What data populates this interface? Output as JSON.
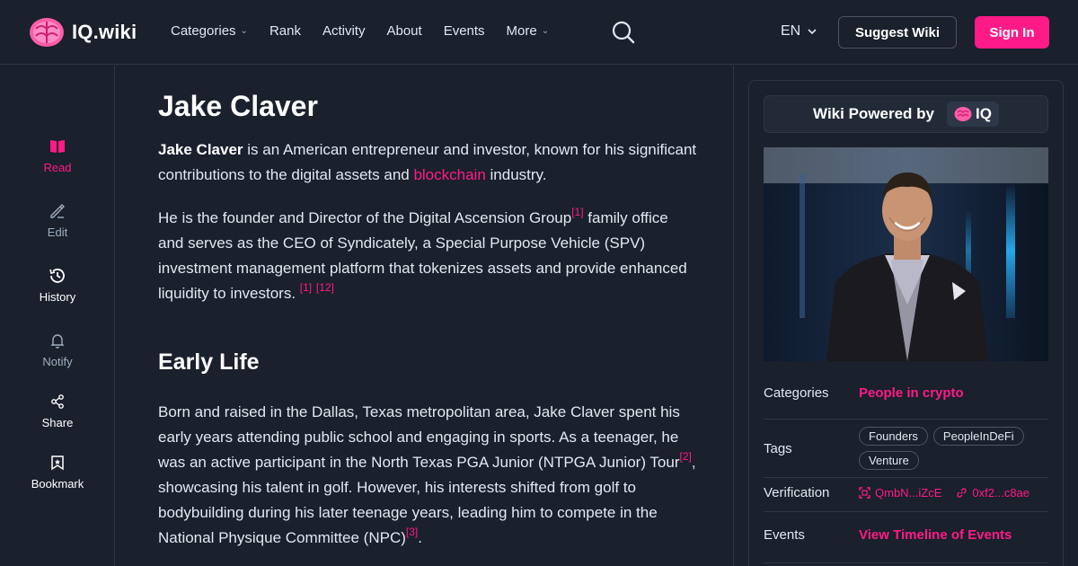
{
  "brand": {
    "name": "IQ.wiki"
  },
  "nav": {
    "links": [
      {
        "label": "Categories",
        "dropdown": true
      },
      {
        "label": "Rank",
        "dropdown": false
      },
      {
        "label": "Activity",
        "dropdown": false
      },
      {
        "label": "About",
        "dropdown": false
      },
      {
        "label": "Events",
        "dropdown": false
      },
      {
        "label": "More",
        "dropdown": true
      }
    ],
    "language": "EN",
    "suggest_label": "Suggest Wiki",
    "signin_label": "Sign In"
  },
  "rail": {
    "read": "Read",
    "edit": "Edit",
    "history": "History",
    "notify": "Notify",
    "share": "Share",
    "bookmark": "Bookmark"
  },
  "article": {
    "title": "Jake Claver",
    "intro_name": "Jake Claver",
    "intro_text_1": " is an American entrepreneur and investor, known for his significant contributions to the digital assets and ",
    "intro_link": "blockchain",
    "intro_text_2": " industry.",
    "p2_text_1": "He is the founder and Director of the Digital Ascension Group",
    "p2_ref_1": "[1]",
    "p2_text_2": " family office and serves as the CEO of Syndicately, a Special Purpose Vehicle (SPV) investment management platform that tokenizes assets and provide enhanced liquidity to investors. ",
    "p2_ref_2": "[1]",
    "p2_ref_3": "[12]",
    "section_early_life": "Early Life",
    "p3_text_1": "Born and raised in the Dallas, Texas metropolitan area, Jake Claver spent his early years attending public school and engaging in sports. As a teenager, he was an active participant in the North Texas PGA Junior (NTPGA Junior) Tour",
    "p3_ref_1": "[2]",
    "p3_text_2": ", showcasing his talent in golf. However, his interests shifted from golf to bodybuilding during his later teenage years, leading him to compete in the National Physique Committee (NPC)",
    "p3_ref_2": "[3]",
    "p3_text_3": "."
  },
  "sidebar": {
    "powered_label": "Wiki Powered by",
    "iq_label": "IQ",
    "categories_label": "Categories",
    "categories_value": "People in crypto",
    "tags_label": "Tags",
    "tags": [
      "Founders",
      "PeopleInDeFi",
      "Venture"
    ],
    "verification_label": "Verification",
    "ipfs_hash": "QmbN...iZcE",
    "tx_hash": "0xf2...c8ae",
    "events_label": "Events",
    "events_link": "View Timeline of Events"
  },
  "colors": {
    "accent": "#ff1a88",
    "background": "#1a202c",
    "border": "#2d3748"
  },
  "icons": [
    "brain-logo-icon",
    "search-icon",
    "chevron-down-icon",
    "book-icon",
    "pencil-icon",
    "history-icon",
    "bell-icon",
    "share-icon",
    "bookmark-icon",
    "ipfs-icon",
    "link-icon"
  ]
}
